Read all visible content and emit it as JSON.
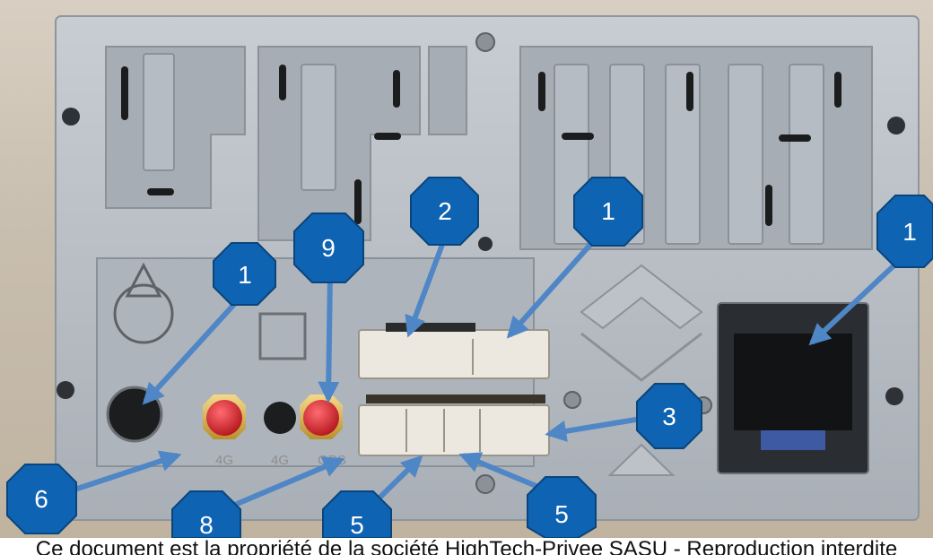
{
  "port_labels": [
    "4G",
    "4G",
    "GPS"
  ],
  "callouts": [
    {
      "name": "callout-1-aux-socket",
      "label": "1"
    },
    {
      "name": "callout-9-gps-antenna",
      "label": "9"
    },
    {
      "name": "callout-2-main-connector",
      "label": "2"
    },
    {
      "name": "callout-1-main-connector",
      "label": "1"
    },
    {
      "name": "callout-1-iso-connector",
      "label": "1"
    },
    {
      "name": "callout-3-lower-connector",
      "label": "3"
    },
    {
      "name": "callout-6-bracket",
      "label": "6"
    },
    {
      "name": "callout-8-antenna-area",
      "label": "8"
    },
    {
      "name": "callout-5-left",
      "label": "5"
    },
    {
      "name": "callout-5-right",
      "label": "5"
    }
  ],
  "footer_caption": "Ce document est la propriété de la société HighTech-Privee SASU - Reproduction interdite",
  "colors": {
    "callout_fill": "#0f63b3",
    "arrow": "#4f86c6",
    "antenna": "#d9222b",
    "panel": "#b9bfc6"
  }
}
